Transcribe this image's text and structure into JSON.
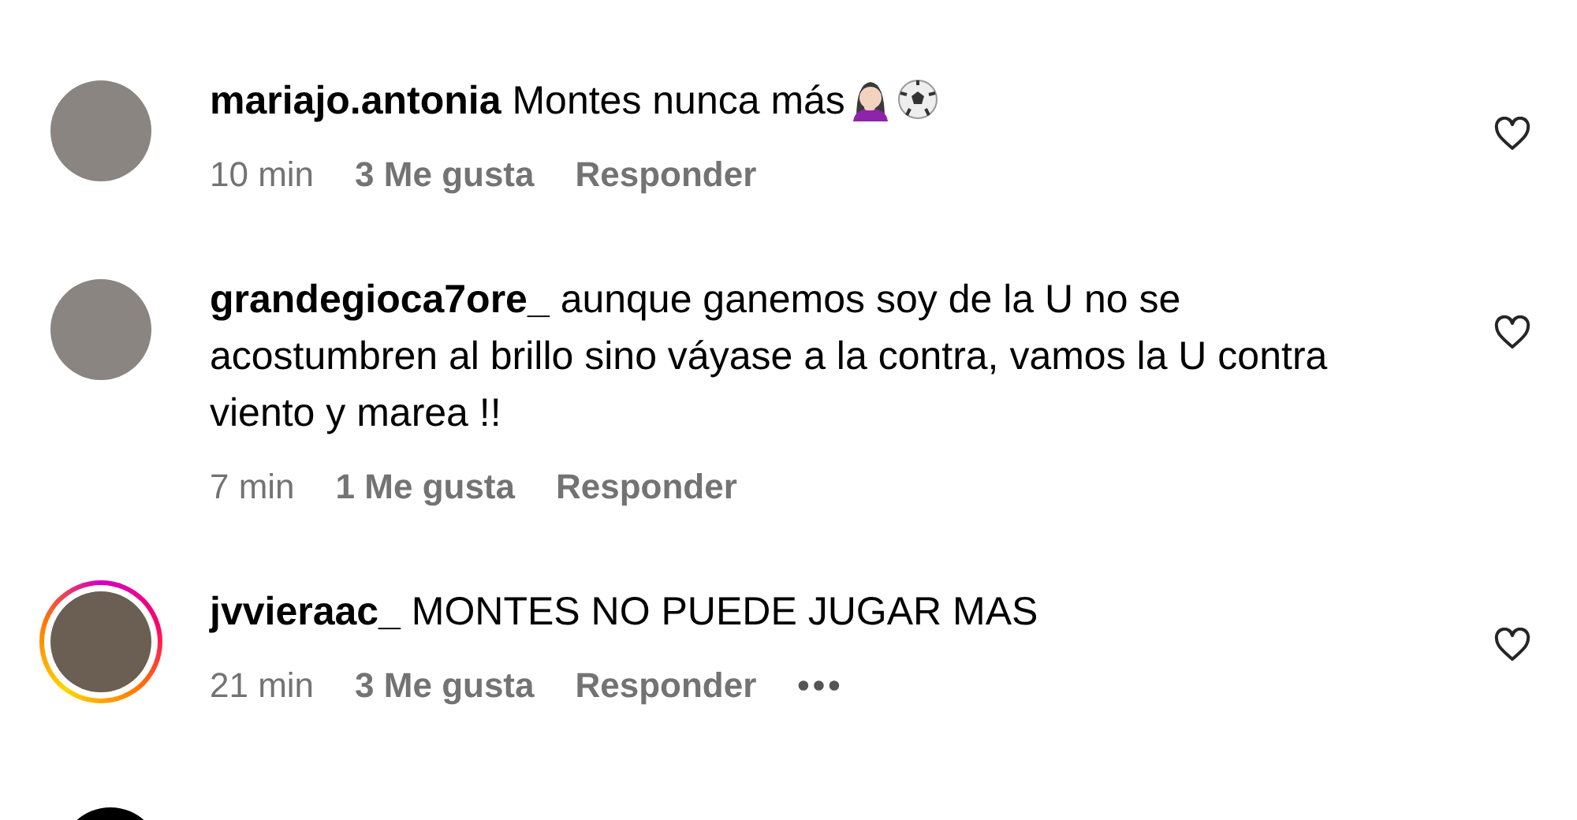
{
  "comments": [
    {
      "username": "mariajo.antonia",
      "text": "Montes nunca más",
      "has_emoji": true,
      "story_ring": false,
      "time": "10 min",
      "likes": "3 Me gusta",
      "reply": "Responder"
    },
    {
      "username": "grandegioca7ore_",
      "text": "aunque ganemos soy de la U no se acostumbren al brillo sino váyase a la contra, vamos la U contra viento y marea !!",
      "has_emoji": false,
      "story_ring": false,
      "time": "7 min",
      "likes": "1 Me gusta",
      "reply": "Responder"
    },
    {
      "username": "jvvieraac_",
      "text": "MONTES NO PUEDE JUGAR MAS",
      "has_emoji": false,
      "story_ring": true,
      "time": "21 min",
      "likes": "3 Me gusta",
      "reply": "Responder",
      "more": "•••"
    }
  ]
}
